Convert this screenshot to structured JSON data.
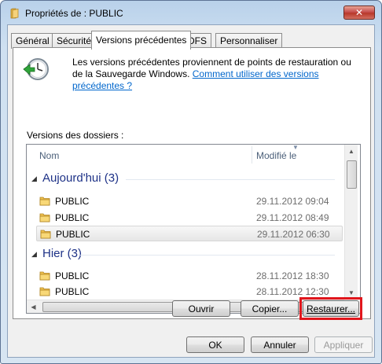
{
  "window": {
    "title": "Propriétés de : PUBLIC",
    "close_glyph": "✕"
  },
  "tabs": [
    {
      "label": "Général"
    },
    {
      "label": "Sécurité"
    },
    {
      "label": "Versions précédentes",
      "active": true
    },
    {
      "label": "DFS"
    },
    {
      "label": "Personnaliser"
    }
  ],
  "info": {
    "text": "Les versions précédentes proviennent de points de restauration ou de la Sauvegarde Windows.",
    "link": "Comment utiliser des versions précédentes ?"
  },
  "folders_label": "Versions des dossiers :",
  "list": {
    "columns": {
      "name": "Nom",
      "date": "Modifié le"
    },
    "groups": [
      {
        "title": "Aujourd'hui (3)",
        "items": [
          {
            "name": "PUBLIC",
            "date": "29.11.2012 09:04"
          },
          {
            "name": "PUBLIC",
            "date": "29.11.2012 08:49"
          },
          {
            "name": "PUBLIC",
            "date": "29.11.2012 06:30",
            "selected": true
          }
        ]
      },
      {
        "title": "Hier (3)",
        "items": [
          {
            "name": "PUBLIC",
            "date": "28.11.2012 18:30"
          },
          {
            "name": "PUBLIC",
            "date": "28.11.2012 12:30"
          }
        ]
      }
    ]
  },
  "actions": {
    "open": "Ouvrir",
    "copy": "Copier...",
    "restore": "Restaurer..."
  },
  "footer": {
    "ok": "OK",
    "cancel": "Annuler",
    "apply": "Appliquer"
  },
  "colors": {
    "highlight": "#e0161c",
    "link": "#0066cc",
    "group_title": "#1e3287"
  }
}
